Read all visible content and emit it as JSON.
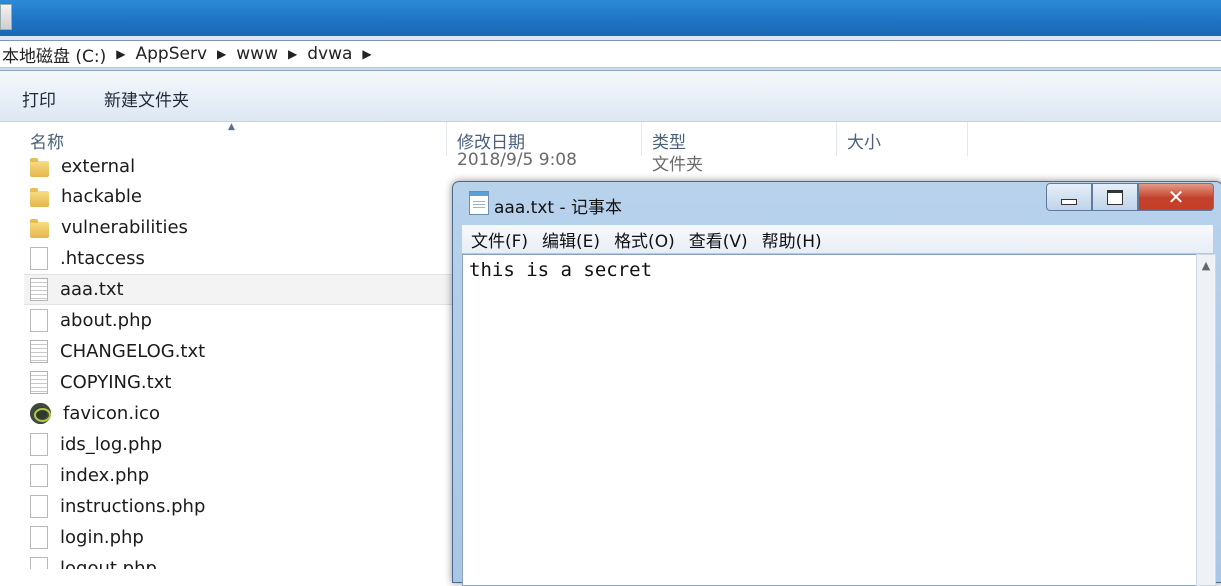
{
  "address": {
    "crumbs": [
      "本地磁盘 (C:)",
      "AppServ",
      "www",
      "dvwa"
    ]
  },
  "toolbar": {
    "print_label": "打印",
    "new_folder_label": "新建文件夹"
  },
  "columns": {
    "name": "名称",
    "modified": "修改日期",
    "type": "类型",
    "size": "大小"
  },
  "background_row": {
    "date": "2018/9/5 9:08",
    "type": "文件夹"
  },
  "files": [
    {
      "name": "external",
      "icon": "folder-icon"
    },
    {
      "name": "hackable",
      "icon": "folder-icon"
    },
    {
      "name": "vulnerabilities",
      "icon": "folder-icon"
    },
    {
      "name": ".htaccess",
      "icon": "file-icon"
    },
    {
      "name": "aaa.txt",
      "icon": "text-file-icon"
    },
    {
      "name": "about.php",
      "icon": "file-icon"
    },
    {
      "name": "CHANGELOG.txt",
      "icon": "text-file-icon"
    },
    {
      "name": "COPYING.txt",
      "icon": "text-file-icon"
    },
    {
      "name": "favicon.ico",
      "icon": "favicon-icon"
    },
    {
      "name": "ids_log.php",
      "icon": "file-icon"
    },
    {
      "name": "index.php",
      "icon": "file-icon"
    },
    {
      "name": "instructions.php",
      "icon": "file-icon"
    },
    {
      "name": "login.php",
      "icon": "file-icon"
    },
    {
      "name": "logout.php",
      "icon": "file-icon"
    }
  ],
  "selected_file": "aaa.txt",
  "notepad": {
    "title": "aaa.txt - 记事本",
    "menu": [
      "文件(F)",
      "编辑(E)",
      "格式(O)",
      "查看(V)",
      "帮助(H)"
    ],
    "content": "this is a secret"
  }
}
